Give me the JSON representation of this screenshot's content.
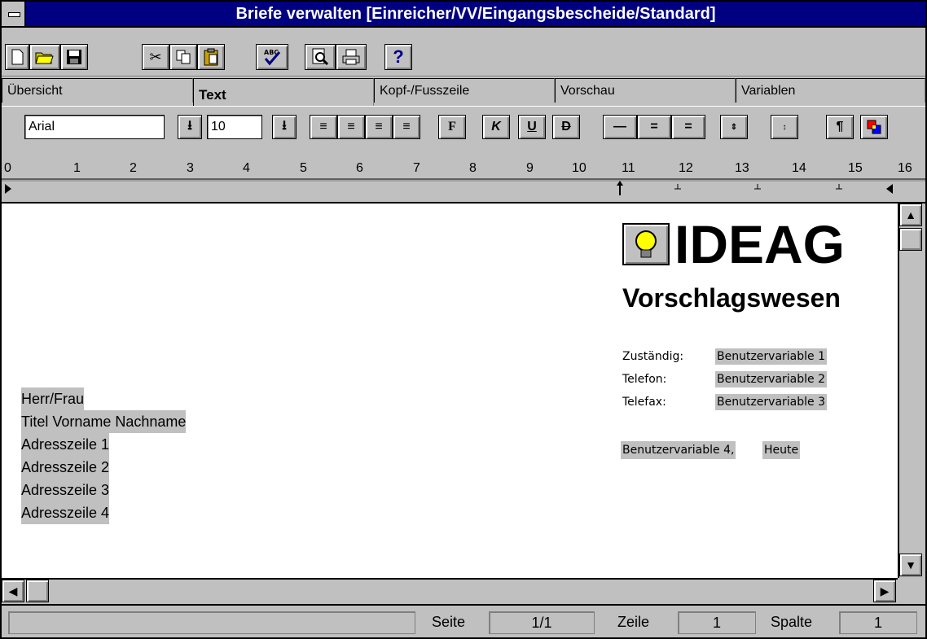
{
  "window": {
    "title": "Briefe verwalten [Einreicher/VV/Eingangsbescheide/Standard]"
  },
  "tabs": [
    {
      "label": "Übersicht",
      "active": false
    },
    {
      "label": "Text",
      "active": true
    },
    {
      "label": "Kopf-/Fusszeile",
      "active": false
    },
    {
      "label": "Vorschau",
      "active": false
    },
    {
      "label": "Variablen",
      "active": false
    }
  ],
  "format": {
    "font": "Arial",
    "size": "10"
  },
  "ruler": {
    "labels": [
      "0",
      "1",
      "2",
      "3",
      "4",
      "5",
      "6",
      "7",
      "8",
      "9",
      "10",
      "11",
      "12",
      "13",
      "14",
      "15",
      "16"
    ]
  },
  "document": {
    "logo": "IDEAG",
    "subtitle": "Vorschlagswesen",
    "info": [
      {
        "label": "Zuständig:",
        "value": "Benutzervariable 1"
      },
      {
        "label": "Telefon:",
        "value": "Benutzervariable 2"
      },
      {
        "label": "Telefax:",
        "value": "Benutzervariable 3"
      }
    ],
    "date_line": {
      "var": "Benutzervariable 4,",
      "date": "Heute"
    },
    "address": [
      "Herr/Frau",
      "Titel Vorname Nachname",
      "Adresszeile 1",
      "Adresszeile 2",
      "Adresszeile 3",
      "Adresszeile 4"
    ]
  },
  "status": {
    "page_label": "Seite",
    "page_value": "1/1",
    "line_label": "Zeile",
    "line_value": "1",
    "col_label": "Spalte",
    "col_value": "1"
  }
}
